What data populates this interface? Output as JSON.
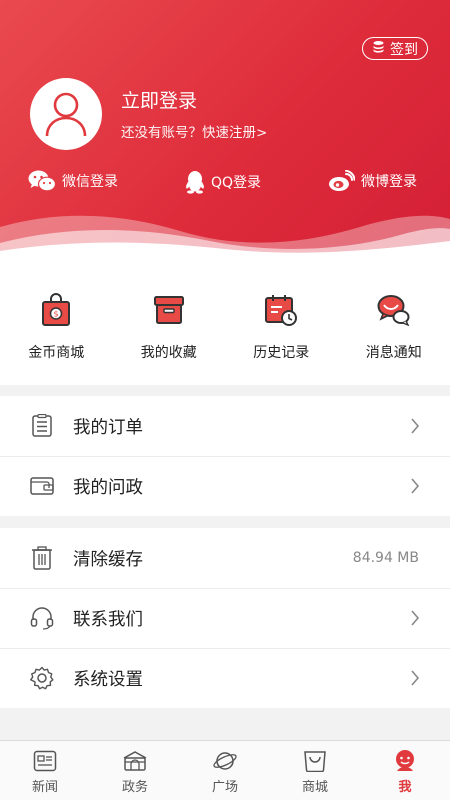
{
  "header": {
    "checkin_label": "签到",
    "login_title": "立即登录",
    "register_prompt": "还没有账号？快速注册>",
    "social": [
      {
        "label": "微信登录",
        "icon": "wechat-icon"
      },
      {
        "label": "QQ登录",
        "icon": "qq-icon"
      },
      {
        "label": "微博登录",
        "icon": "weibo-icon"
      }
    ]
  },
  "quick": [
    {
      "label": "金币商城",
      "icon": "coin-shop-icon"
    },
    {
      "label": "我的收藏",
      "icon": "favorites-box-icon"
    },
    {
      "label": "历史记录",
      "icon": "history-calendar-icon"
    },
    {
      "label": "消息通知",
      "icon": "message-chat-icon"
    }
  ],
  "menu_group1": [
    {
      "label": "我的订单",
      "icon": "order-list-icon"
    },
    {
      "label": "我的问政",
      "icon": "wallet-icon"
    }
  ],
  "menu_group2": [
    {
      "label": "清除缓存",
      "icon": "trash-icon",
      "value": "84.94 MB"
    },
    {
      "label": "联系我们",
      "icon": "headset-icon"
    },
    {
      "label": "系统设置",
      "icon": "settings-gear-icon"
    }
  ],
  "tabbar": [
    {
      "label": "新闻",
      "icon": "news-icon"
    },
    {
      "label": "政务",
      "icon": "government-icon"
    },
    {
      "label": "广场",
      "icon": "planet-icon"
    },
    {
      "label": "商城",
      "icon": "shopping-bag-icon"
    },
    {
      "label": "我",
      "icon": "me-avatar-icon",
      "active": true
    }
  ],
  "colors": {
    "accent": "#e03a3e",
    "header_start": "#e94a4f",
    "header_end": "#d41f35"
  }
}
